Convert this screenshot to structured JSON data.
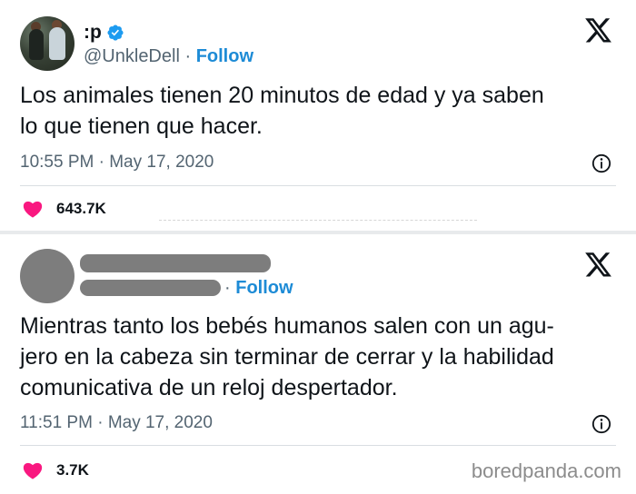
{
  "tweets": [
    {
      "display_name": ":p",
      "handle": "@UnkleDell",
      "separator": "·",
      "follow_label": "Follow",
      "text_lines": [
        "Los animales tienen 20 minutos de edad y ya saben",
        "lo que tienen que hacer."
      ],
      "time": "10:55 PM",
      "date": "May 17, 2020",
      "likes": "643.7K",
      "avatar_icon": "user-photo",
      "verified_icon": "verified-badge-icon"
    },
    {
      "display_name": "",
      "handle": "",
      "separator": "·",
      "follow_label": "Follow",
      "text_lines": [
        "Mientras tanto los bebés humanos salen con un agu-",
        "jero en la cabeza sin terminar de cerrar y la habilidad",
        "comunicativa de un reloj despertador."
      ],
      "time": "11:51 PM",
      "date": "May 17, 2020",
      "likes": "3.7K",
      "avatar_icon": "redacted-avatar"
    }
  ],
  "watermark": "boredpanda.com",
  "colors": {
    "follow": "#1d8bd6",
    "heart": "#f91880",
    "verified": "#1d9bf0",
    "muted_text": "#536471",
    "redaction": "#7d7d7d"
  },
  "icons": {
    "close": "x-logo-icon",
    "info": "info-icon",
    "like": "heart-icon"
  }
}
